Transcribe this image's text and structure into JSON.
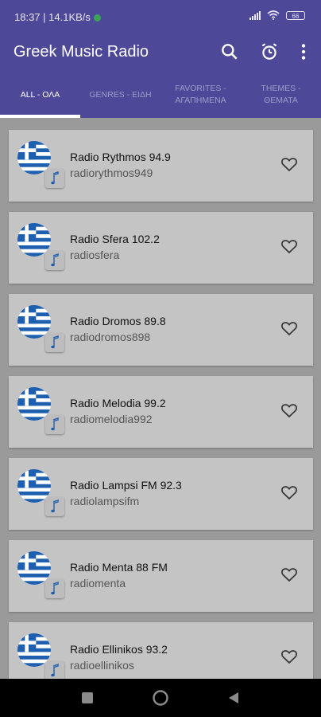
{
  "status": {
    "time": "18:37",
    "speed": "14.1KB/s",
    "battery": "66"
  },
  "app": {
    "title": "Greek Music Radio"
  },
  "tabs": [
    {
      "line1": "ALL - ΟΛΑ",
      "line2": ""
    },
    {
      "line1": "GENRES - ΕΙΔΗ",
      "line2": ""
    },
    {
      "line1": "FAVORITES -",
      "line2": "ΑΓΑΠΗΜΕΝΑ"
    },
    {
      "line1": "THEMES -",
      "line2": "ΘΕΜΑΤΑ"
    }
  ],
  "stations": [
    {
      "name": "Radio Rythmos 94.9",
      "id": "radiorythmos949"
    },
    {
      "name": "Radio Sfera 102.2",
      "id": "radiosfera"
    },
    {
      "name": "Radio Dromos 89.8",
      "id": "radiodromos898"
    },
    {
      "name": "Radio Melodia 99.2",
      "id": "radiomelodia992"
    },
    {
      "name": "Radio Lampsi FM 92.3",
      "id": "radiolampsifm"
    },
    {
      "name": "Radio Menta 88 FM",
      "id": "radiomenta"
    },
    {
      "name": "Radio Ellinikos 93.2",
      "id": "radioellinikos"
    }
  ],
  "icons": {
    "search": "search-icon",
    "alarm": "alarm-icon",
    "menu": "more-vert-icon",
    "flag": "greek-flag-icon",
    "note": "music-note-icon",
    "heart": "heart-outline-icon"
  },
  "colors": {
    "primary": "#4d4898",
    "card": "#c4c4c4",
    "flag_blue": "#1f5fb0"
  }
}
